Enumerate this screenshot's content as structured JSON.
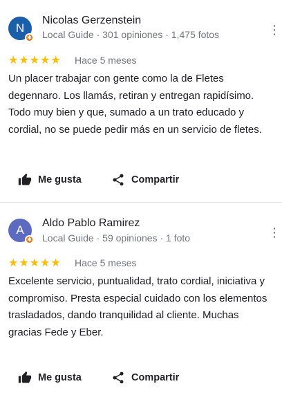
{
  "reviews": [
    {
      "avatar_initial": "N",
      "avatar_color": "#1a5fa8",
      "name": "Nicolas Gerzenstein",
      "meta": "Local Guide · 301 opiniones · 1,475 fotos",
      "stars": "★★★★★",
      "rating": 5,
      "date": "Hace 5 meses",
      "text": "Un placer trabajar con gente como la de Fletes degennaro. Los llamás, retiran y entregan rapidísimo. Todo muy bien y que, sumado a un trato educado y cordial, no se puede pedir más en un servicio de fletes.",
      "like_label": "Me gusta",
      "share_label": "Compartir"
    },
    {
      "avatar_initial": "A",
      "avatar_color": "#5c6bc0",
      "name": "Aldo Pablo Ramirez",
      "meta": "Local Guide · 59 opiniones · 1 foto",
      "stars": "★★★★★",
      "rating": 5,
      "date": "Hace 5 meses",
      "text": "Excelente servicio, puntualidad, trato cordial, iniciativa y compromiso. Presta especial cuidado con los elementos trasladados, dando tranquilidad al cliente. Muchas gracias Fede y Eber.",
      "like_label": "Me gusta",
      "share_label": "Compartir"
    }
  ],
  "colors": {
    "star": "#fbbc04",
    "badge": "#e8710a",
    "meta_text": "#70757a"
  },
  "icons": {
    "like": "thumbs-up-icon",
    "share": "share-icon",
    "menu": "more-vert-icon",
    "badge": "local-guide-badge-icon"
  }
}
